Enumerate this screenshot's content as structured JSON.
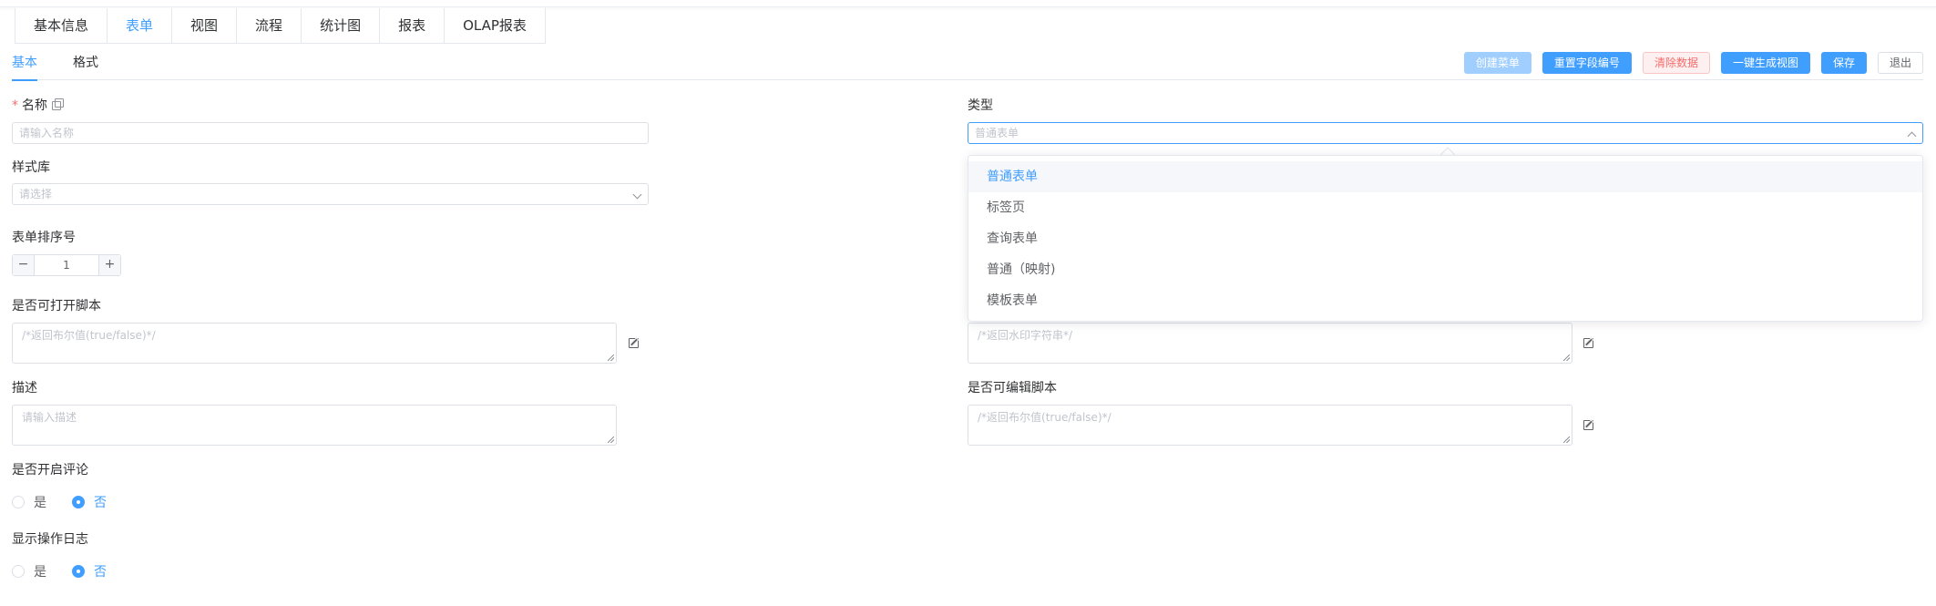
{
  "tabs": [
    {
      "label": "基本信息"
    },
    {
      "label": "表单"
    },
    {
      "label": "视图"
    },
    {
      "label": "流程"
    },
    {
      "label": "统计图"
    },
    {
      "label": "报表"
    },
    {
      "label": "OLAP报表"
    }
  ],
  "active_tab": "表单",
  "subtabs": [
    {
      "label": "基本"
    },
    {
      "label": "格式"
    }
  ],
  "toolbar": {
    "create_menu": "创建菜单",
    "reset_field_no": "重置字段编号",
    "clear_data": "清除数据",
    "generate_view": "一键生成视图",
    "save": "保存",
    "exit": "退出"
  },
  "form": {
    "name": {
      "label": "名称",
      "required_mark": "*",
      "placeholder": "请输入名称"
    },
    "type": {
      "label": "类型",
      "value": "普通表单"
    },
    "style_lib": {
      "label": "样式库",
      "placeholder": "请选择"
    },
    "sort_no": {
      "label": "表单排序号",
      "value": "1",
      "minus": "−",
      "plus": "+"
    },
    "open_script": {
      "label": "是否可打开脚本",
      "placeholder": "/*返回布尔值(true/false)*/"
    },
    "watermark_script": {
      "placeholder": "/*返回水印字符串*/"
    },
    "description": {
      "label": "描述",
      "placeholder": "请输入描述"
    },
    "edit_script": {
      "label": "是否可编辑脚本",
      "placeholder": "/*返回布尔值(true/false)*/"
    },
    "comments": {
      "label": "是否开启评论",
      "yes": "是",
      "no": "否",
      "selected": "否"
    },
    "oplog": {
      "label": "显示操作日志",
      "yes": "是",
      "no": "否",
      "selected": "否"
    }
  },
  "type_dropdown": {
    "options": [
      "普通表单",
      "标签页",
      "查询表单",
      "普通（映射)",
      "模板表单"
    ],
    "selected": "普通表单"
  },
  "colors": {
    "accent": "#409eff",
    "danger": "#f56c6c",
    "disabled": "#a0cfff"
  },
  "icons": {
    "copy": "copy-icon",
    "edit": "edit-icon",
    "chevron_down": "chevron-down-icon",
    "chevron_up": "chevron-up-icon"
  }
}
